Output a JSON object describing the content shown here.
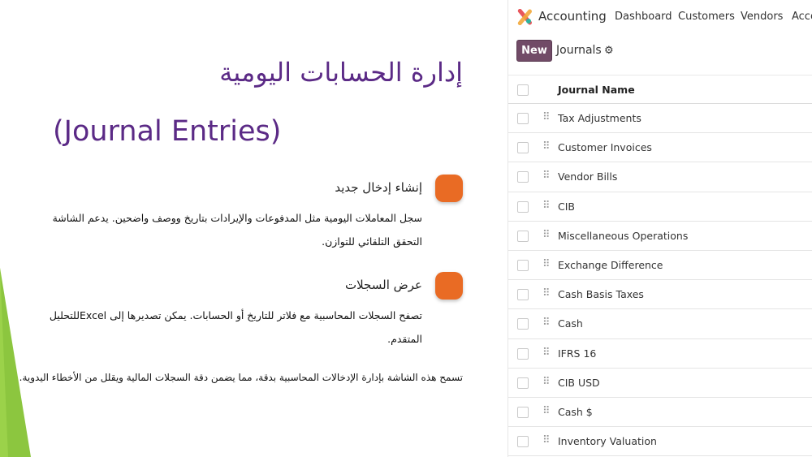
{
  "slide": {
    "title_ar": "إدارة الحسابات اليومية",
    "title_en": "(Journal Entries)",
    "sections": [
      {
        "heading": "إنشاء إدخال جديد",
        "body": "سجل المعاملات اليومية مثل المدفوعات والإيرادات بتاريخ ووصف واضحين. يدعم الشاشة التحقق التلقائي للتوازن."
      },
      {
        "heading": "عرض السجلات",
        "body": "تصفح السجلات المحاسبية مع فلاتر للتاريخ أو الحسابات. يمكن تصديرها إلى Excelللتحليل المتقدم."
      }
    ],
    "footer": "تسمح هذه الشاشة بإدارة الإدخالات المحاسبية بدقة، مما يضمن دقة السجلات المالية ويقلل من الأخطاء اليدوية.",
    "colors": {
      "title": "#5b2a86",
      "bullet": "#e96b24",
      "accent": "#8cc63f"
    }
  },
  "app": {
    "name": "Accounting",
    "nav": [
      "Dashboard",
      "Customers",
      "Vendors",
      "Acco"
    ],
    "new_label": "New",
    "breadcrumb": "Journals",
    "icons": {
      "logo": "odoo-accounting-logo",
      "gear": "gear-icon",
      "handle": "drag-handle-icon"
    },
    "colors": {
      "primary": "#714b67"
    },
    "table": {
      "column": "Journal Name",
      "rows": [
        "Tax Adjustments",
        "Customer Invoices",
        "Vendor Bills",
        "CIB",
        "Miscellaneous Operations",
        "Exchange Difference",
        "Cash Basis Taxes",
        "Cash",
        "IFRS 16",
        "CIB USD",
        "Cash $",
        "Inventory Valuation"
      ]
    }
  }
}
